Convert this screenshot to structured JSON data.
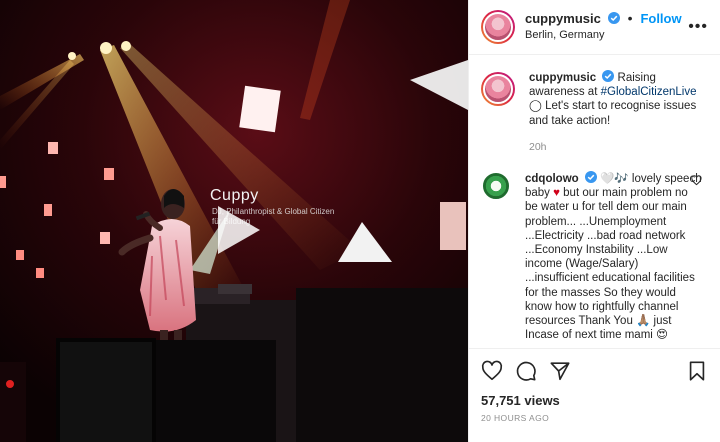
{
  "media": {
    "stage_title": "Cuppy",
    "stage_subtitle_line1": "DJ, Philanthropist & Global Citizen",
    "stage_subtitle_line2": "für Bildung"
  },
  "header": {
    "username": "cuppymusic",
    "follow_label": "Follow",
    "location": "Berlin, Germany"
  },
  "caption": {
    "username": "cuppymusic",
    "text_before": "Raising awareness at ",
    "hashtag": "#GlobalCitizenLive",
    "text_after": " ◯ Let's start to recognise issues and take action!",
    "time": "20h"
  },
  "comment": {
    "username": "cdqolowo",
    "emoji": "🤍🎶",
    "line1": " lovely speech baby ",
    "heart": "♥",
    "line2": " but our main problem no be water u for tell dem our main problem... ...Unemployment ...Electricity ...bad road network ...Economy Instability ...Low income (Wage/Salary) ...insufficient educational facilities for the masses So they would know how to rightfully channel resources Thank You ",
    "emoji2": "🙏🏽",
    "line3": " just Incase of next time mami ",
    "emoji3": "😍"
  },
  "stats": {
    "views": "57,751 views",
    "posted": "20 HOURS AGO"
  },
  "colors": {
    "link_blue": "#0095f6",
    "hashtag": "#00376b",
    "muted": "#8e8e8e",
    "heart_red": "#d0021b"
  },
  "icons": [
    "verified-badge-icon",
    "more-options-icon",
    "play-icon",
    "like-icon",
    "comment-icon",
    "share-icon",
    "save-icon",
    "small-heart-icon"
  ]
}
